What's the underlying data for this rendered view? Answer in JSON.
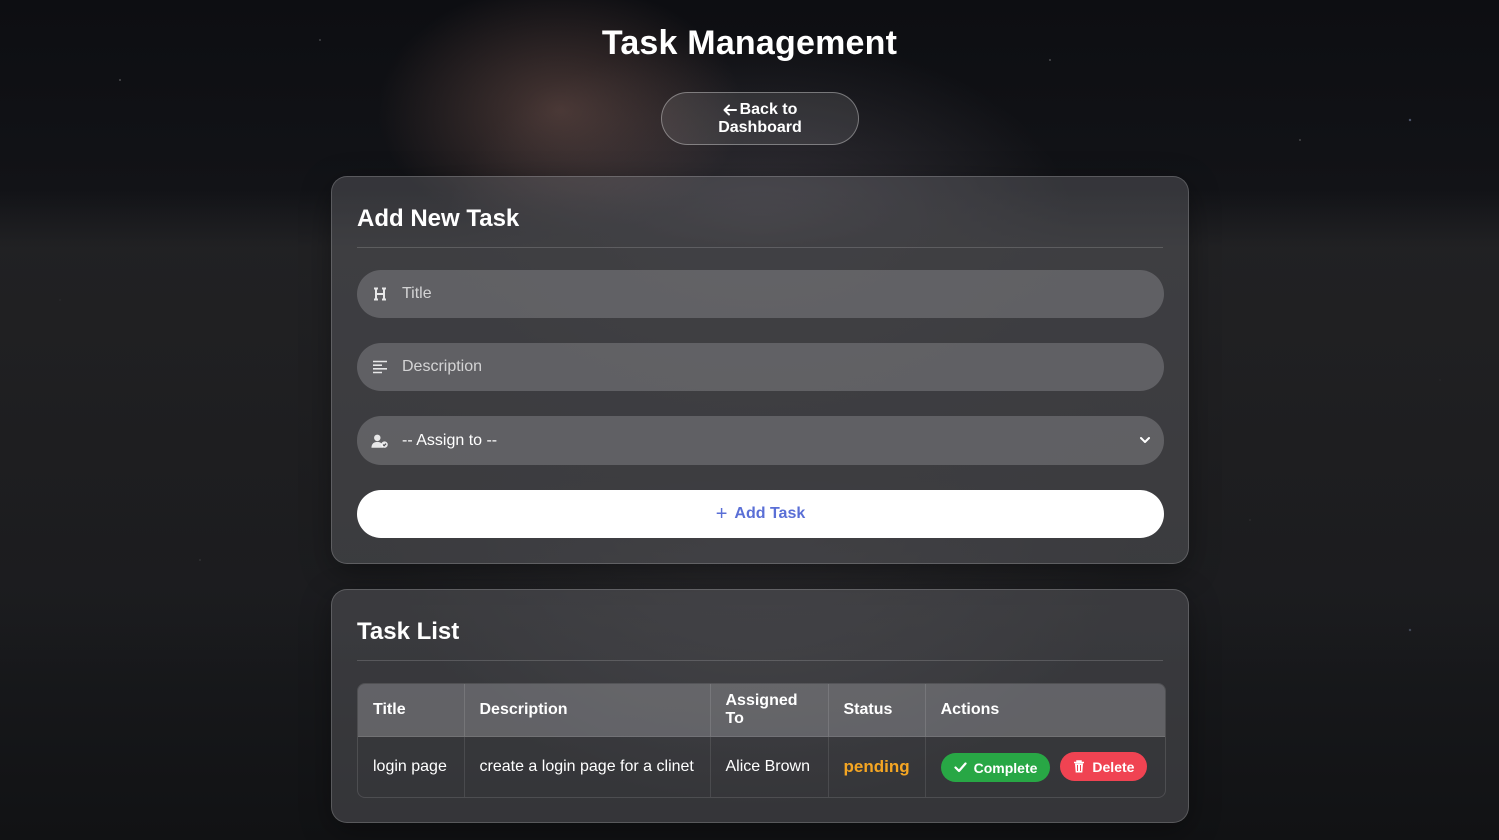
{
  "header": {
    "title": "Task Management",
    "back_label": "Back to Dashboard"
  },
  "add_task": {
    "heading": "Add New Task",
    "title_placeholder": "Title",
    "description_placeholder": "Description",
    "assign_selected": "-- Assign to --",
    "submit_label": "Add Task"
  },
  "task_list": {
    "heading": "Task List",
    "columns": [
      "Title",
      "Description",
      "Assigned To",
      "Status",
      "Actions"
    ],
    "rows": [
      {
        "title": "login page",
        "description": "create a login page for a clinet",
        "assigned_to": "Alice Brown",
        "status": "pending",
        "complete_label": "Complete",
        "delete_label": "Delete"
      }
    ]
  },
  "colors": {
    "accent": "#5a6fd6",
    "status_pending": "#f5a623",
    "complete": "#28a745",
    "delete": "#f04352"
  },
  "icons": {
    "back": "arrow-left-icon",
    "title": "heading-icon",
    "description": "align-left-icon",
    "assign": "user-check-icon",
    "add": "plus-icon",
    "complete": "check-icon",
    "delete": "trash-icon"
  }
}
